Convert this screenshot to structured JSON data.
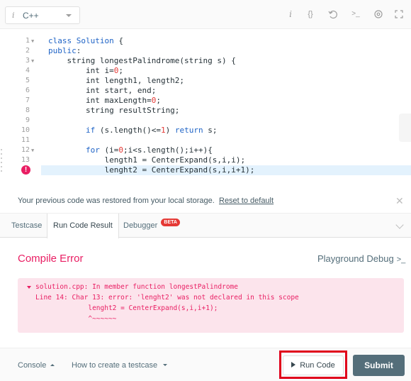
{
  "toolbar": {
    "language": "C++",
    "icons": [
      "info-icon",
      "braces-icon",
      "reset-icon",
      "terminal-icon",
      "settings-icon",
      "fullscreen-icon"
    ]
  },
  "editor": {
    "lines": [
      {
        "num": "1",
        "fold": true,
        "code": "class Solution {"
      },
      {
        "num": "2",
        "fold": false,
        "code": "public:"
      },
      {
        "num": "3",
        "fold": true,
        "code": "    string longestPalindrome(string s) {"
      },
      {
        "num": "4",
        "fold": false,
        "code": "        int i=0;"
      },
      {
        "num": "5",
        "fold": false,
        "code": "        int length1, length2;"
      },
      {
        "num": "6",
        "fold": false,
        "code": "        int start, end;"
      },
      {
        "num": "7",
        "fold": false,
        "code": "        int maxLength=0;"
      },
      {
        "num": "8",
        "fold": false,
        "code": "        string resultString;"
      },
      {
        "num": "9",
        "fold": false,
        "code": ""
      },
      {
        "num": "10",
        "fold": false,
        "code": "        if (s.length()<=1) return s;"
      },
      {
        "num": "11",
        "fold": false,
        "code": ""
      },
      {
        "num": "12",
        "fold": true,
        "code": "        for (i=0;i<s.length();i++){"
      },
      {
        "num": "13",
        "fold": false,
        "code": "            length1 = CenterExpand(s,i,i);"
      },
      {
        "num": "14",
        "fold": false,
        "error": true,
        "code": "            lenght2 = CenterExpand(s,i,i+1);"
      }
    ]
  },
  "banner": {
    "message": "Your previous code was restored from your local storage.",
    "reset_link": "Reset to default"
  },
  "tabs": {
    "testcase": "Testcase",
    "run_result": "Run Code Result",
    "debugger": "Debugger",
    "beta": "BETA"
  },
  "result": {
    "title": "Compile Error",
    "playground_debug": "Playground Debug",
    "playground_icon": ">_",
    "error_lines": [
      "solution.cpp: In member function longestPalindrome",
      "Line 14: Char 13: error: 'lenght2' was not declared in this scope",
      "             lenght2 = CenterExpand(s,i,i+1);",
      "             ^~~~~~~"
    ],
    "error_color": "#e91e63"
  },
  "footer": {
    "console": "Console",
    "how_to": "How to create a testcase",
    "run_code": "Run Code",
    "submit": "Submit"
  }
}
